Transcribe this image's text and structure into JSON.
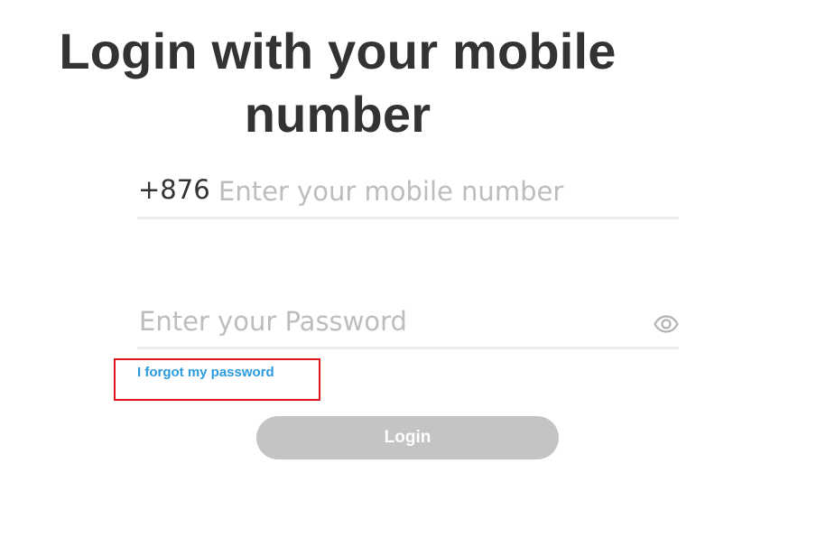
{
  "page": {
    "title": "Login with your mobile number"
  },
  "phone": {
    "prefix": "+876",
    "placeholder": "Enter your mobile number",
    "value": ""
  },
  "password": {
    "placeholder": "Enter your Password",
    "value": "",
    "toggle_icon": "eye-icon"
  },
  "forgot_link": {
    "label": "I forgot my password",
    "highlight_color": "#e0141b",
    "color": "#2b9be0"
  },
  "login_button": {
    "label": "Login",
    "state": "disabled",
    "color": "#c4c4c4"
  }
}
